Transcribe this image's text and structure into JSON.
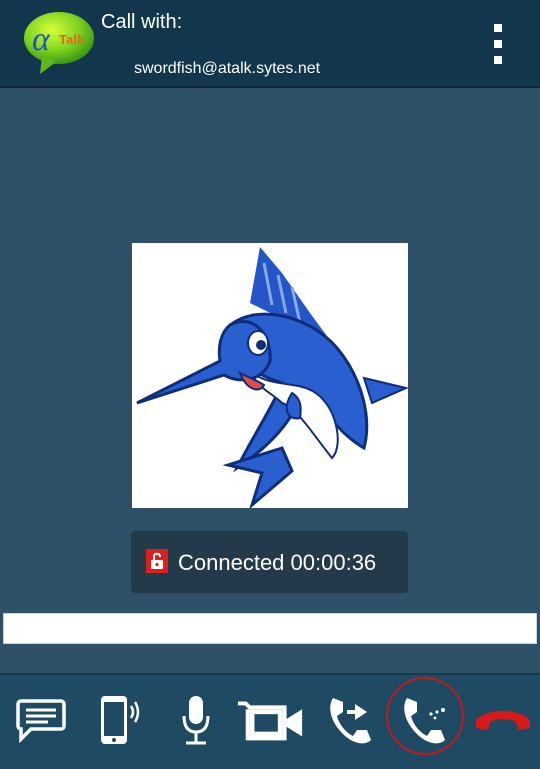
{
  "header": {
    "logo_text": "Talk",
    "title": "Call with:",
    "contact": "swordfish@atalk.sytes.net"
  },
  "call": {
    "status": "Connected 00:00:36"
  },
  "input": {
    "value": ""
  },
  "toolbar": {
    "buttons": [
      {
        "name": "chat",
        "icon": "chat-bubble-icon"
      },
      {
        "name": "phone-vibrate",
        "icon": "phone-vibrate-icon"
      },
      {
        "name": "microphone",
        "icon": "microphone-icon"
      },
      {
        "name": "video",
        "icon": "video-camera-icon"
      },
      {
        "name": "transfer",
        "icon": "call-transfer-icon"
      },
      {
        "name": "dialpad",
        "icon": "call-dialpad-icon",
        "active": true
      },
      {
        "name": "hangup",
        "icon": "hangup-icon"
      }
    ]
  },
  "colors": {
    "background": "#2f5168",
    "header": "#12364b",
    "toolbar": "#1e4a63",
    "hangup": "#d81a1a",
    "active_ring": "#c81818"
  }
}
